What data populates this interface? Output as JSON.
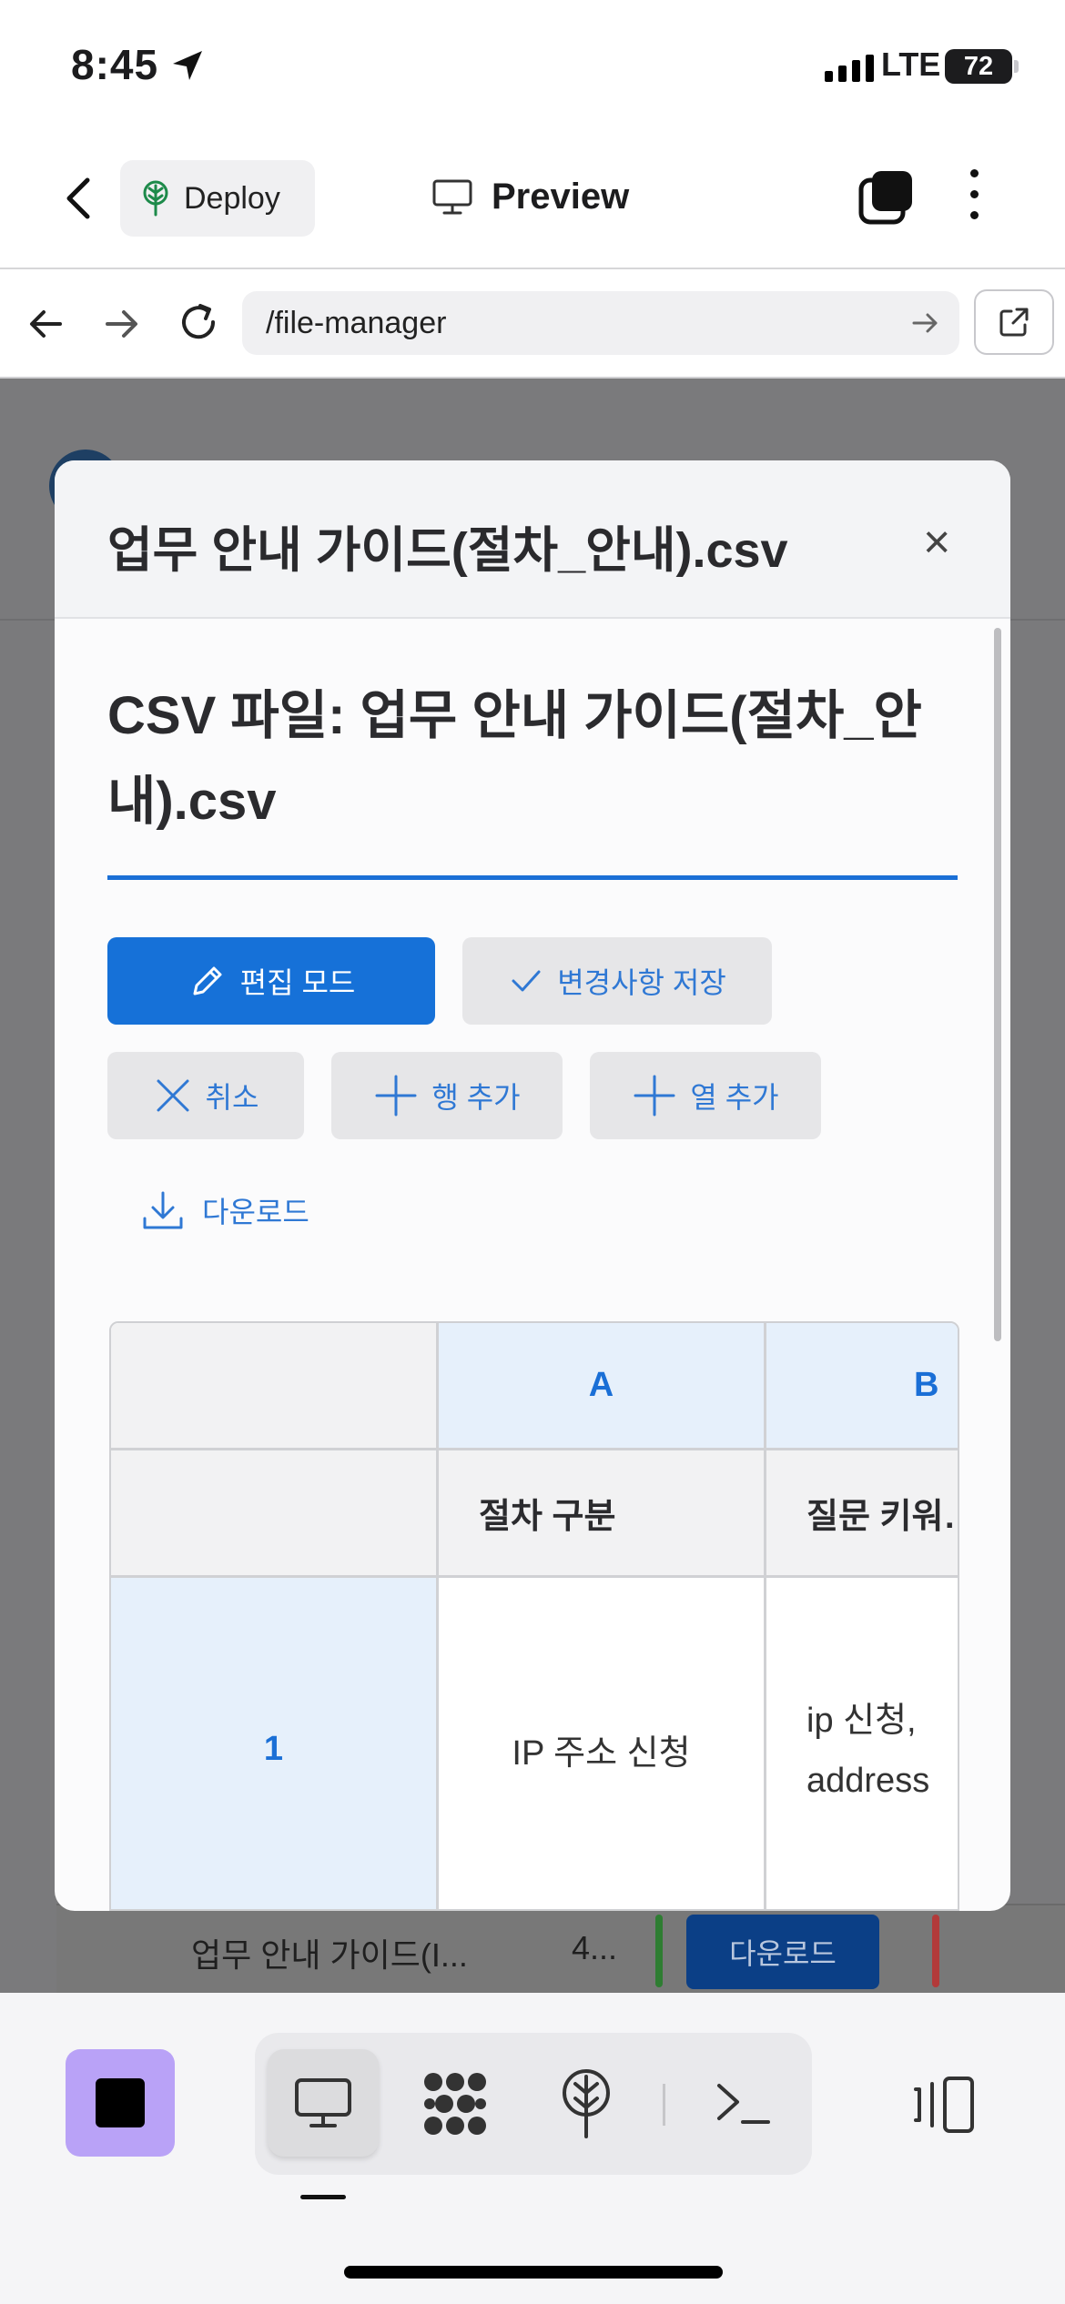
{
  "status_bar": {
    "time": "8:45",
    "network": "LTE",
    "battery": "72"
  },
  "app_header": {
    "deploy_label": "Deploy",
    "preview_label": "Preview"
  },
  "browser": {
    "url": "/file-manager"
  },
  "background_list": {
    "row_name": "업무 안내 가이드(I...",
    "row_size": "4...",
    "download_label": "다운로드"
  },
  "modal": {
    "title": "업무 안내 가이드(절차_안내).csv",
    "close_label": "×",
    "csv_heading": "CSV 파일: 업무 안내 가이드(절차_안내).csv",
    "buttons": {
      "edit_mode": "편집 모드",
      "save_changes": "변경사항 저장",
      "cancel": "취소",
      "add_row": "행 추가",
      "add_col": "열 추가",
      "download": "다운로드"
    },
    "table": {
      "column_letters": [
        "A",
        "B"
      ],
      "headers": [
        "절차 구분",
        "질문 키워…"
      ],
      "rows": [
        {
          "num": "1",
          "cells": [
            "IP 주소 신청",
            "ip 신청,\naddress"
          ]
        }
      ]
    }
  },
  "accent_colors": {
    "primary": "#1671d8",
    "stop_button": "#b9a2f7"
  }
}
